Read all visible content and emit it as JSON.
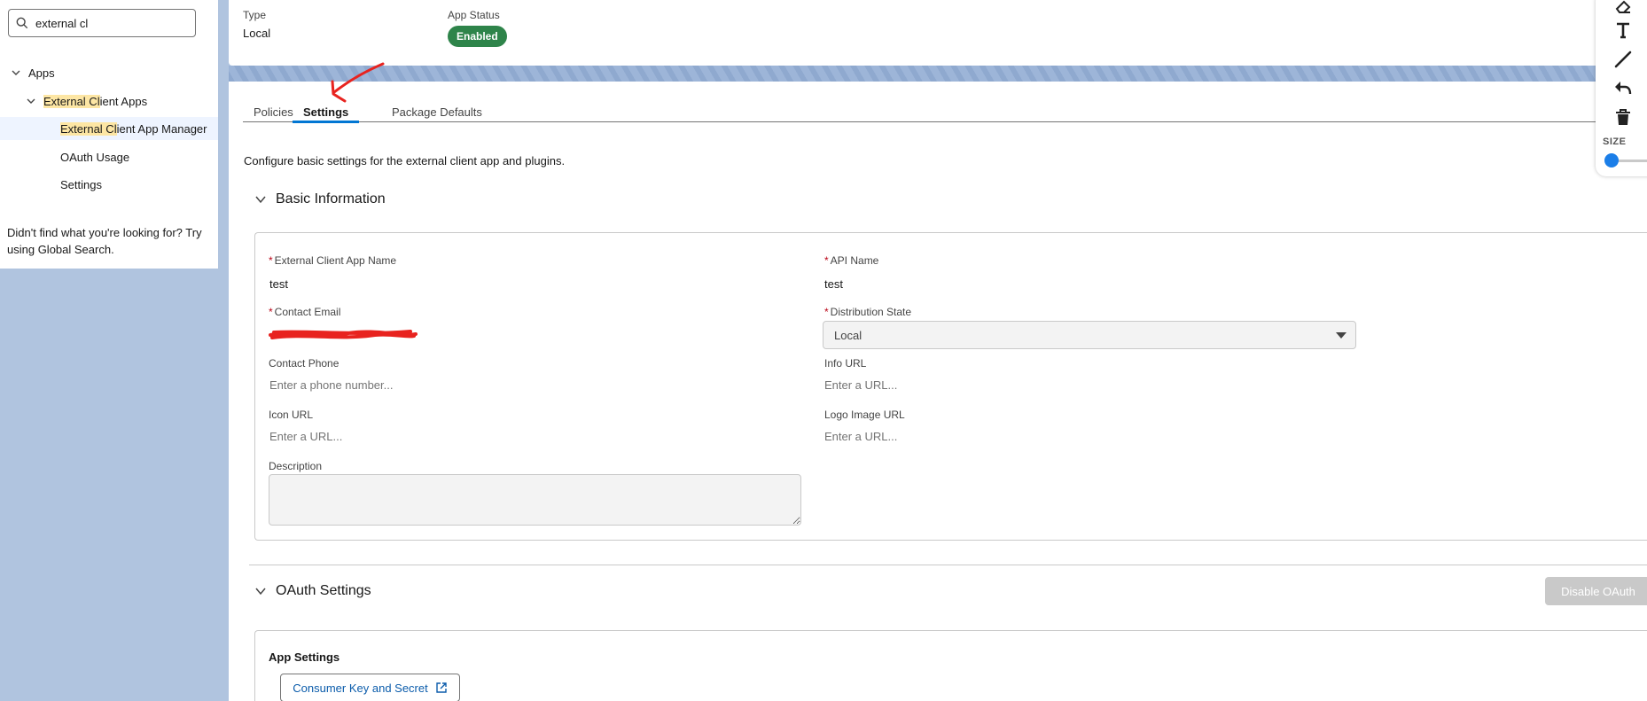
{
  "sidebar": {
    "search_value": "external cl",
    "tree": {
      "apps": "Apps",
      "external_client_apps_hl": "External Cl",
      "external_client_apps_rest": "ient Apps",
      "manager_hl": "External Cl",
      "manager_rest": "ient App Manager",
      "oauth_usage": "OAuth Usage",
      "settings": "Settings"
    },
    "help_text": "Didn't find what you're looking for? Try using Global Search."
  },
  "header": {
    "type_label": "Type",
    "type_value": "Local",
    "status_label": "App Status",
    "status_value": "Enabled"
  },
  "tabs": [
    {
      "label": "Policies"
    },
    {
      "label": "Settings"
    },
    {
      "label": "Package Defaults"
    }
  ],
  "description": "Configure basic settings for the external client app and plugins.",
  "basic_info": {
    "title": "Basic Information",
    "required_mark": "*",
    "app_name_label": "External Client App Name",
    "app_name_value": "test",
    "api_name_label": "API Name",
    "api_name_value": "test",
    "contact_email_label": "Contact Email",
    "distribution_label": "Distribution State",
    "distribution_value": "Local",
    "contact_phone_label": "Contact Phone",
    "contact_phone_placeholder": "Enter a phone number...",
    "info_url_label": "Info URL",
    "info_url_placeholder": "Enter a URL...",
    "icon_url_label": "Icon URL",
    "icon_url_placeholder": "Enter a URL...",
    "logo_url_label": "Logo Image URL",
    "logo_url_placeholder": "Enter a URL...",
    "description_label": "Description"
  },
  "oauth": {
    "title": "OAuth Settings",
    "disable_button": "Disable OAuth",
    "app_settings_label": "App Settings",
    "consumer_key_button": "Consumer Key and Secret"
  },
  "tool_panel": {
    "size_label": "SIZE"
  },
  "colors": {
    "brand": "#0176d3",
    "enabled_badge": "#2e844a",
    "required": "#ba0517",
    "annotation": "#e8231f",
    "background": "#b0c4df"
  }
}
